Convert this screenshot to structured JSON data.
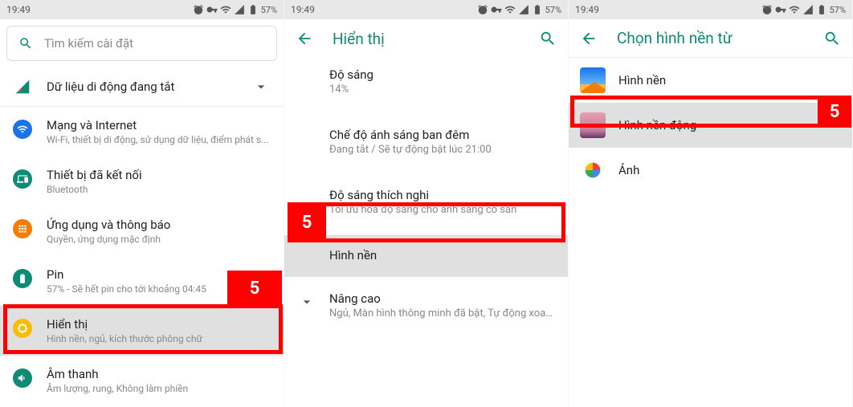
{
  "status": {
    "time": "19:49",
    "battery": "57%"
  },
  "screen1": {
    "search_placeholder": "Tìm kiếm cài đặt",
    "mobile_data": "Dữ liệu di động đang tắt",
    "items": [
      {
        "title": "Mạng và Internet",
        "sub": "Wi-Fi, thiết bị di động, sử dụng dữ liệu, điểm phát s..."
      },
      {
        "title": "Thiết bị đã kết nối",
        "sub": "Bluetooth"
      },
      {
        "title": "Ứng dụng và thông báo",
        "sub": "Quyền, ứng dụng mặc định"
      },
      {
        "title": "Pin",
        "sub": "57% - Sẽ hết pin cho tới khoảng 04:45"
      },
      {
        "title": "Hiển thị",
        "sub": "Hình nền, ngủ, kích thước phông chữ"
      },
      {
        "title": "Âm thanh",
        "sub": "Âm lượng, rung, Không làm phiền"
      }
    ]
  },
  "screen2": {
    "title": "Hiển thị",
    "items": [
      {
        "title": "Độ sáng",
        "sub": "14%"
      },
      {
        "title": "Chế độ ánh sáng ban đêm",
        "sub": "Đang tắt / Sẽ tự động bật lúc 21:00"
      },
      {
        "title": "Độ sáng thích nghi",
        "sub": "Tối ưu hóa độ sáng cho ánh sáng có sẵn"
      },
      {
        "title": "Hình nền",
        "sub": ""
      }
    ],
    "advanced": {
      "title": "Nâng cao",
      "sub": "Ngủ, Màn hình thông minh đã bật, Tự động xoay mà..."
    }
  },
  "screen3": {
    "title": "Chọn hình nền từ",
    "items": [
      {
        "label": "Hình nền"
      },
      {
        "label": "Hình nền động"
      },
      {
        "label": "Ảnh"
      }
    ]
  },
  "annotation": "5"
}
